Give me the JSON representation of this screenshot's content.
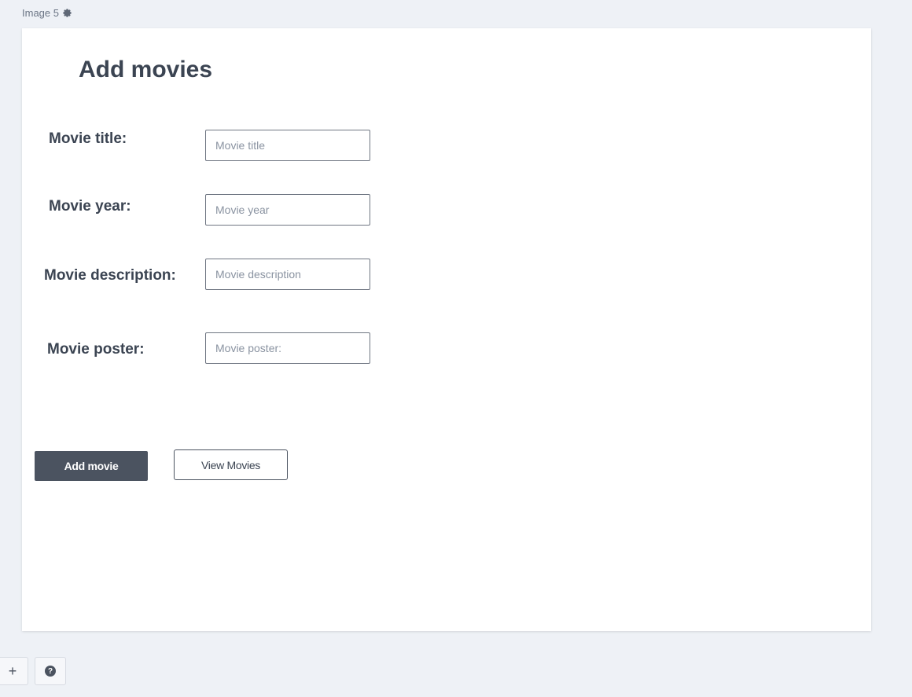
{
  "page": {
    "label": "Image 5",
    "settings_icon": "gear-icon"
  },
  "form": {
    "title": "Add movies",
    "fields": [
      {
        "label": "Movie title:",
        "placeholder": "Movie title"
      },
      {
        "label": "Movie year:",
        "placeholder": "Movie year"
      },
      {
        "label": "Movie description:",
        "placeholder": "Movie description"
      },
      {
        "label": "Movie poster:",
        "placeholder": "Movie poster:"
      }
    ],
    "add_button": "Add movie",
    "view_button": "View Movies"
  },
  "toolbar": {
    "add_icon": "plus-icon",
    "add_symbol": "+",
    "help_icon": "question-icon",
    "help_symbol": "?"
  },
  "colors": {
    "background": "#eef1f6",
    "canvas": "#ffffff",
    "text": "#3b4452",
    "primary_button": "#4b5360"
  }
}
